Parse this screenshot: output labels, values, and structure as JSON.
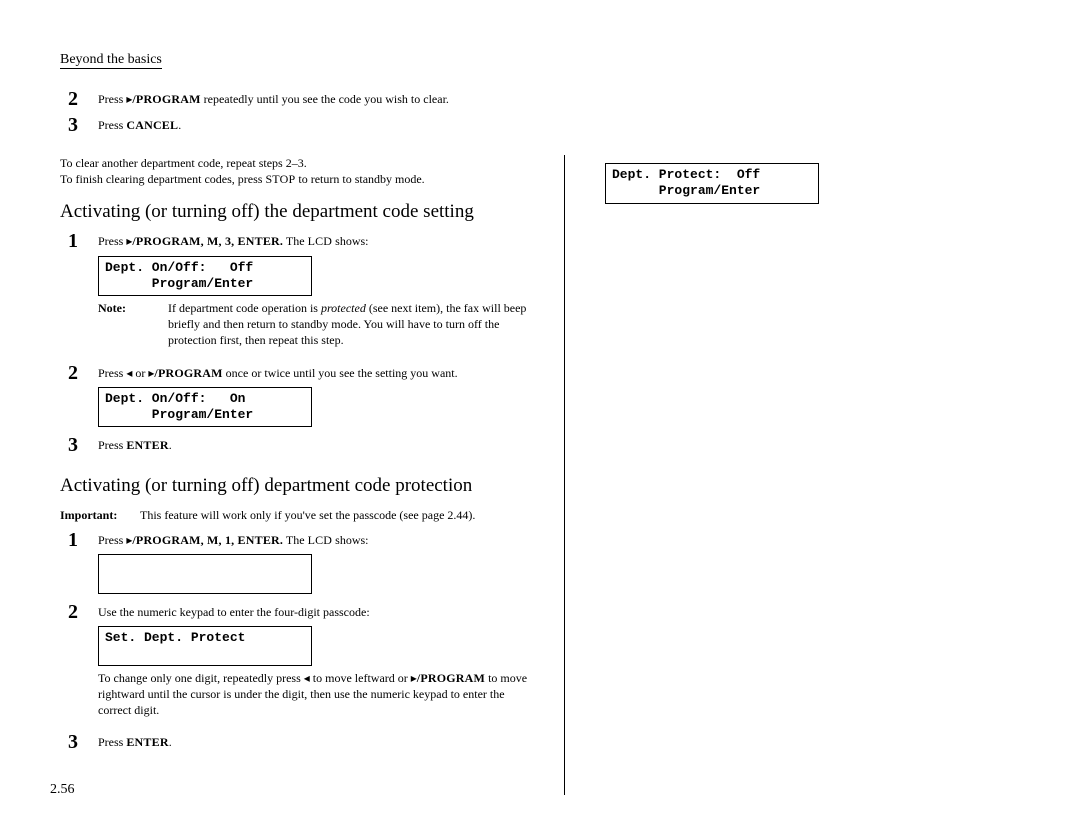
{
  "header": "Beyond the basics",
  "top_steps": {
    "s2": {
      "num": "2",
      "pre": "Press ",
      "arrow": "▸",
      "key": "/PROGRAM",
      "post": " repeatedly until you see the code you wish to clear."
    },
    "s3": {
      "num": "3",
      "pre": "Press ",
      "key": "CANCEL",
      "post": "."
    }
  },
  "clear_para_l1": "To clear another department code, repeat steps 2–3.",
  "clear_para_l2a": "To finish clearing department codes, press ",
  "clear_para_l2b": "STOP",
  "clear_para_l2c": " to return to standby mode.",
  "heading1": "Activating (or turning off) the department code setting",
  "sec1": {
    "s1": {
      "num": "1",
      "pre": "Press ",
      "arrow": "▸",
      "key": "/PROGRAM, M, 3, ENTER.",
      "post": " The ",
      "lcd_word": "LCD",
      "post2": " shows:"
    },
    "lcd1": "Dept. On/Off:   Off\n      Program/Enter",
    "note_label": "Note:",
    "note_text_a": "If department code operation is ",
    "note_text_b": "protected",
    "note_text_c": " (see next item), the fax will beep briefly and then return to standby mode. You will have to turn off the protection first, then repeat this step.",
    "s2": {
      "num": "2",
      "pre": "Press ",
      "arrowL": "◂",
      "mid": " or ",
      "arrowR": "▸",
      "key": "/PROGRAM",
      "post": " once or twice until you see the setting you want."
    },
    "lcd2": "Dept. On/Off:   On\n      Program/Enter",
    "s3": {
      "num": "3",
      "pre": "Press ",
      "key": "ENTER",
      "post": "."
    }
  },
  "heading2": "Activating (or turning off) department code protection",
  "sec2": {
    "imp_label": "Important:",
    "imp_text": "This feature will work only if you've set the passcode (see page 2.44).",
    "s1": {
      "num": "1",
      "pre": "Press ",
      "arrow": "▸",
      "key": "/PROGRAM, M, 1, ENTER.",
      "post": " The ",
      "lcd_word": "LCD",
      "post2": " shows:"
    },
    "lcd1": "",
    "s2": {
      "num": "2",
      "text": "Use the numeric keypad to enter the four-digit passcode:"
    },
    "lcd2": "Set. Dept. Protect",
    "sub_a": "To change only one digit, repeatedly press ",
    "sub_arrL": "◂",
    "sub_b": " to move leftward or ",
    "sub_arrR": "▸",
    "sub_key": "/PROGRAM",
    "sub_c": " to move rightward until the cursor is under the digit, then use the numeric keypad to enter the correct digit.",
    "s3": {
      "num": "3",
      "pre": "Press ",
      "key": "ENTER",
      "post": "."
    }
  },
  "right_lcd": "Dept. Protect:  Off\n      Program/Enter",
  "footer": "2.56"
}
